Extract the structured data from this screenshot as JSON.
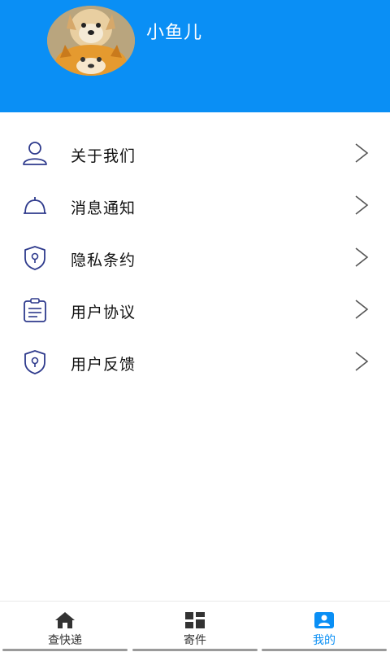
{
  "header": {
    "username": "小鱼儿",
    "avatar_icon": "shiba-dog-avatar",
    "background_color": "#0a8ff5"
  },
  "menu": {
    "items": [
      {
        "label": "关于我们",
        "icon": "user-icon"
      },
      {
        "label": "消息通知",
        "icon": "bell-icon"
      },
      {
        "label": "隐私条约",
        "icon": "shield-icon"
      },
      {
        "label": "用户协议",
        "icon": "clipboard-icon"
      },
      {
        "label": "用户反馈",
        "icon": "shield-icon"
      }
    ],
    "icon_color": "#2e3a8c"
  },
  "bottom_nav": {
    "tabs": [
      {
        "label": "查快递",
        "icon": "home-icon",
        "active": false
      },
      {
        "label": "寄件",
        "icon": "grid-icon",
        "active": false
      },
      {
        "label": "我的",
        "icon": "profile-card-icon",
        "active": true
      }
    ],
    "active_color": "#0a8ff5"
  }
}
